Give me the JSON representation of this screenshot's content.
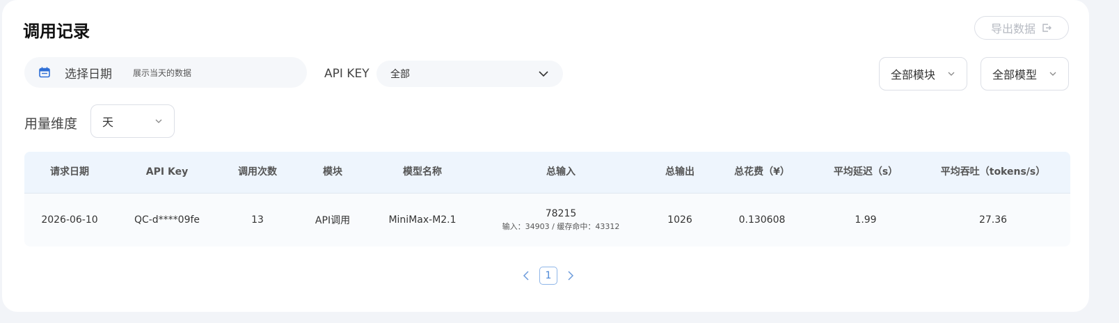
{
  "header": {
    "title": "调用记录",
    "export_label": "导出数据"
  },
  "filters": {
    "date_label": "选择日期",
    "date_hint": "展示当天的数据",
    "apikey_label": "API KEY",
    "apikey_value": "全部",
    "module_value": "全部模块",
    "model_value": "全部模型",
    "usage_label": "用量维度",
    "usage_value": "天"
  },
  "table": {
    "columns": [
      "请求日期",
      "API Key",
      "调用次数",
      "模块",
      "模型名称",
      "总输入",
      "总输出",
      "总花费（¥）",
      "平均延迟（s）",
      "平均吞吐（tokens/s）"
    ],
    "rows": [
      {
        "date": "2026-06-10",
        "api_key": "QC-d****09fe",
        "calls": "13",
        "module": "API调用",
        "model": "MiniMax-M2.1",
        "total_input": "78215",
        "input_detail": "输入：34903 / 缓存命中：43312",
        "total_output": "1026",
        "total_cost": "0.130608",
        "avg_latency": "1.99",
        "avg_throughput": "27.36"
      }
    ]
  },
  "pagination": {
    "current_page": "1"
  },
  "colors": {
    "accent": "#4a86d6",
    "table_header_bg": "#eef5fd",
    "card_bg": "#ffffff",
    "page_bg": "#f2f4f8"
  }
}
